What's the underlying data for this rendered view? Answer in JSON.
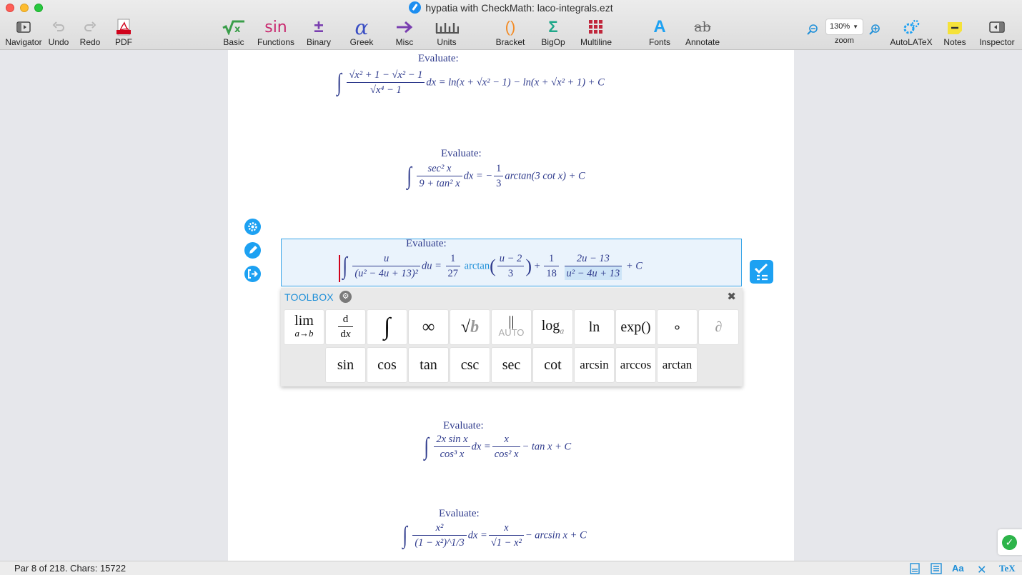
{
  "window": {
    "title": "hypatia with CheckMath: laco-integrals.ezt"
  },
  "toolbar": {
    "navigator": "Navigator",
    "undo": "Undo",
    "redo": "Redo",
    "pdf": "PDF",
    "basic": "Basic",
    "functions": "Functions",
    "functions_glyph": "sin",
    "binary": "Binary",
    "binary_glyph": "±",
    "greek": "Greek",
    "greek_glyph": "α",
    "misc": "Misc",
    "units": "Units",
    "bracket": "Bracket",
    "bracket_glyph": "()",
    "bigop": "BigOp",
    "bigop_glyph": "Σ",
    "multiline": "Multiline",
    "fonts": "Fonts",
    "fonts_glyph": "A",
    "annotate": "Annotate",
    "annotate_glyph": "ab",
    "zoom_value": "130%",
    "zoom_label": "zoom",
    "autolatex": "AutoLATeX",
    "notes": "Notes",
    "inspector": "Inspector"
  },
  "document": {
    "eval_label": "Evaluate:",
    "eq1": {
      "num": "√x² + 1 − √x² − 1",
      "den": "√x⁴ − 1",
      "rhs": "dx = ln(x + √x² − 1) − ln(x + √x² + 1) + C"
    },
    "eq2": {
      "num": "sec² x",
      "den": "9 + tan² x",
      "mid": "dx = −",
      "c_num": "1",
      "c_den": "3",
      "rhs": "arctan(3 cot x) + C"
    },
    "eq3": {
      "num": "u",
      "den": "(u² − 4u + 13)²",
      "mid": "du =",
      "a_num": "1",
      "a_den": "27",
      "arctan": "arctan",
      "b_num": "u − 2",
      "b_den": "3",
      "plus": "+",
      "c_num": "1",
      "c_den": "18",
      "d_num": "2u − 13",
      "d_den": "u² − 4u + 13",
      "tail": "+ C"
    },
    "eq4": {
      "num": "2x sin x",
      "den": "cos³ x",
      "mid": "dx =",
      "r_num": "x",
      "r_den": "cos² x",
      "rhs": "− tan x + C"
    },
    "eq5": {
      "num": "x²",
      "den": "(1 − x²)^1/3",
      "mid": "dx =",
      "r_num": "x",
      "r_den": "√1 − x²",
      "rhs": "− arcsin x + C"
    }
  },
  "toolbox": {
    "title": "TOOLBOX",
    "row1": [
      "lim a→b",
      "d/dx",
      "∫",
      "∞",
      "√b",
      "AUTO",
      "logₐ",
      "ln",
      "exp()",
      "∘",
      "∂"
    ],
    "row2": [
      "sin",
      "cos",
      "tan",
      "csc",
      "sec",
      "cot",
      "arcsin",
      "arccos",
      "arctan"
    ]
  },
  "status": {
    "text": "Par 8 of 218. Chars: 15722",
    "aa": "Aa",
    "tex": "TeX"
  },
  "colors": {
    "accent": "#1da1f2",
    "math": "#2e3a8c",
    "ok": "#2db44a"
  }
}
